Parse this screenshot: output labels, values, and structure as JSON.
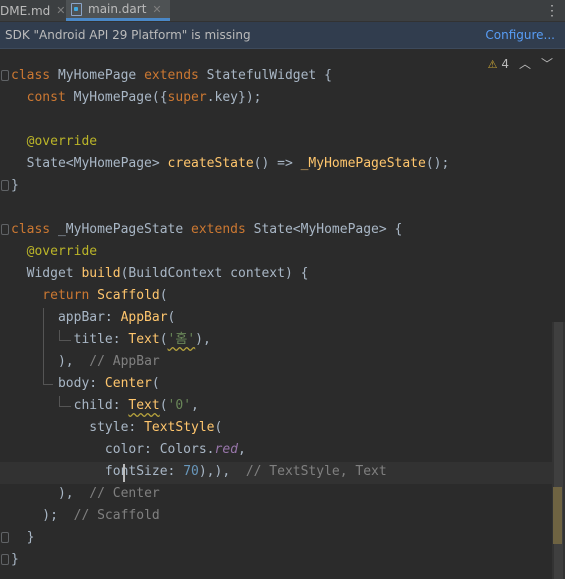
{
  "tabs": [
    {
      "label": "DME.md",
      "active": false
    },
    {
      "label": "main.dart",
      "active": true
    }
  ],
  "banner": {
    "message": "SDK \"Android API 29 Platform\" is missing",
    "link": "Configure..."
  },
  "inspections": {
    "warning_count": "4"
  },
  "code": {
    "l1": [
      "class",
      " MyHomePage ",
      "extends",
      " StatefulWidget {"
    ],
    "l2": [
      "  const",
      " MyHomePage({",
      "super",
      ".key});"
    ],
    "l4": [
      "  @override"
    ],
    "l5": [
      "  State<MyHomePage> ",
      "createState",
      "() => ",
      "_MyHomePageState",
      "();"
    ],
    "l6": [
      "}"
    ],
    "l8": [
      "class",
      " _MyHomePageState ",
      "extends",
      " State<MyHomePage> {"
    ],
    "l9": [
      "  @override"
    ],
    "l10": [
      "  Widget ",
      "build",
      "(BuildContext context) {"
    ],
    "l11": [
      "    return",
      " ",
      "Scaffold",
      "("
    ],
    "l12": [
      "      appBar: ",
      "AppBar",
      "("
    ],
    "l13": [
      "        title: ",
      "Text",
      "(",
      "'홈'",
      "),"
    ],
    "l14": [
      "      ),  ",
      "// AppBar"
    ],
    "l15": [
      "      body: ",
      "Center",
      "("
    ],
    "l16": [
      "        child: ",
      "Text",
      "(",
      "'0'",
      ","
    ],
    "l17": [
      "          style: ",
      "TextStyle",
      "("
    ],
    "l18": [
      "            color: Colors.",
      "red",
      ","
    ],
    "l19": [
      "            fontSize: ",
      "70",
      "),),  ",
      "// TextStyle, Text"
    ],
    "l20": [
      "      ),  ",
      "// Center"
    ],
    "l21": [
      "    );  ",
      "// Scaffold"
    ],
    "l22": [
      "  }"
    ],
    "l23": [
      "}"
    ]
  }
}
